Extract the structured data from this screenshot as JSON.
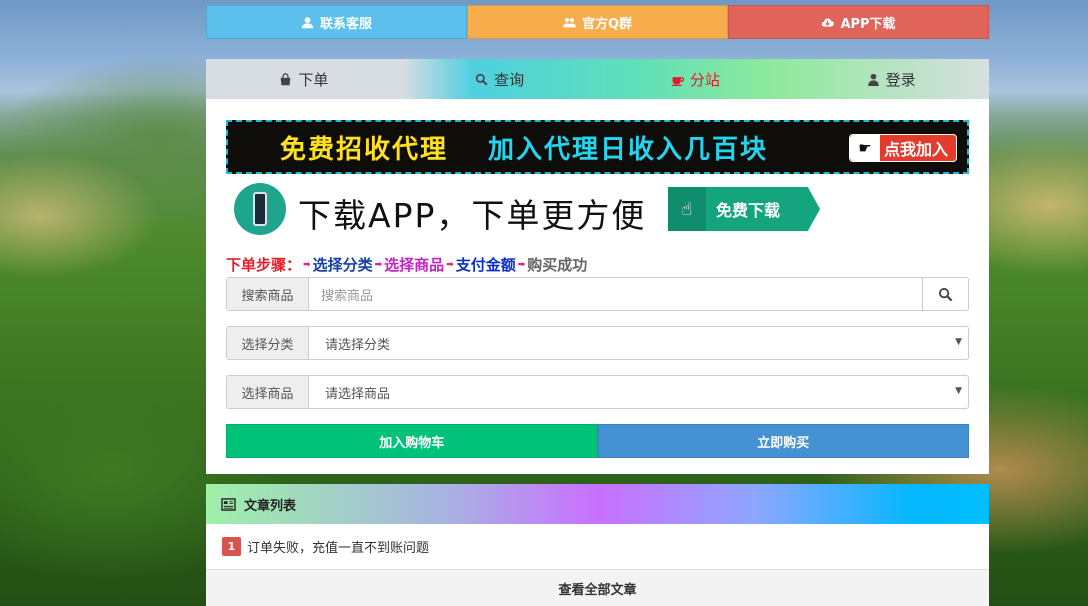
{
  "topbar": {
    "contact_label": "联系客服",
    "qq_group_label": "官方Q群",
    "app_download_label": "APP下载",
    "colors": {
      "contact": "#5bc0eb",
      "qq_group": "#f8ad4d",
      "app_download": "#e0645a"
    },
    "icons": {
      "contact": "user-icon",
      "qq_group": "users-icon",
      "app_download": "cloud-download-icon"
    }
  },
  "nav": {
    "tabs": [
      {
        "label": "下单",
        "icon": "shopping-bag-icon"
      },
      {
        "label": "查询",
        "icon": "search-icon"
      },
      {
        "label": "分站",
        "icon": "coffee-cup-icon",
        "color": "#e8172c"
      },
      {
        "label": "登录",
        "icon": "user-icon"
      }
    ]
  },
  "banner_agent": {
    "text_yellow": "免费招收代理",
    "text_cyan": "加入代理日收入几百块",
    "join_label": "点我加入"
  },
  "banner_app": {
    "text": "下载APP，下单更方便",
    "download_label": "免费下载"
  },
  "steps": {
    "title": "下单步骤：",
    "items": [
      "选择分类",
      "选择商品",
      "支付金额",
      "购买成功"
    ]
  },
  "form": {
    "search": {
      "label": "搜索商品",
      "placeholder": "搜索商品",
      "value": ""
    },
    "category": {
      "label": "选择分类",
      "selected": "请选择分类"
    },
    "product": {
      "label": "选择商品",
      "selected": "请选择商品"
    }
  },
  "actions": {
    "add_cart_label": "加入购物车",
    "buy_now_label": "立即购买",
    "colors": {
      "add_cart": "#00c279",
      "buy_now": "#4592d3"
    }
  },
  "articles": {
    "header": "文章列表",
    "items": [
      {
        "index": "1",
        "title": "订单失败，充值一直不到账问题"
      }
    ],
    "view_all_label": "查看全部文章"
  }
}
